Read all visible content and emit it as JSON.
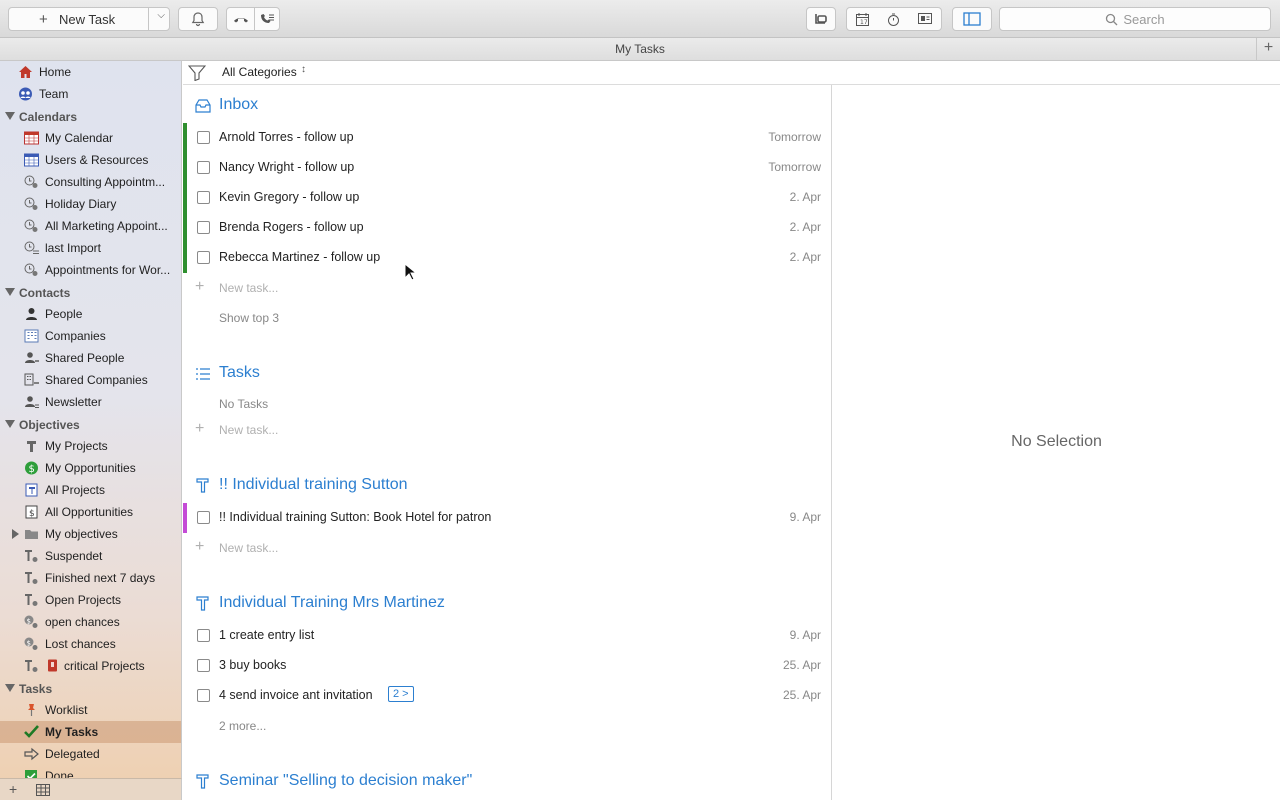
{
  "toolbar": {
    "new_task_label": "New Task",
    "search_placeholder": "Search"
  },
  "window": {
    "title": "My Tasks"
  },
  "filter": {
    "label": "All Categories"
  },
  "sidebar": {
    "top": [
      {
        "label": "Home",
        "icon": "home-icon"
      },
      {
        "label": "Team",
        "icon": "team-icon"
      }
    ],
    "sections": {
      "calendars": "Calendars",
      "contacts": "Contacts",
      "objectives": "Objectives",
      "tasks": "Tasks"
    },
    "calendars": [
      "My Calendar",
      "Users & Resources",
      "Consulting Appointm...",
      "Holiday Diary",
      "All Marketing Appoint...",
      "last Import",
      "Appointments for Wor..."
    ],
    "contacts": [
      "People",
      "Companies",
      "Shared People",
      "Shared Companies",
      "Newsletter"
    ],
    "objectives": [
      "My Projects",
      "My Opportunities",
      "All Projects",
      "All Opportunities",
      "My objectives",
      "Suspendet",
      "Finished next 7 days",
      "Open Projects",
      "open chances",
      "Lost chances",
      "critical Projects"
    ],
    "tasks": [
      "Worklist",
      "My Tasks",
      "Delegated",
      "Done"
    ]
  },
  "groups": {
    "inbox": {
      "title": "Inbox",
      "tasks": [
        {
          "title": "Arnold Torres - follow up",
          "date": "Tomorrow"
        },
        {
          "title": "Nancy Wright - follow up",
          "date": "Tomorrow"
        },
        {
          "title": "Kevin Gregory - follow up",
          "date": "2. Apr"
        },
        {
          "title": "Brenda Rogers - follow up",
          "date": "2. Apr"
        },
        {
          "title": "Rebecca Martinez - follow up",
          "date": "2. Apr"
        }
      ],
      "new_task": "New task...",
      "show_top": "Show top 3"
    },
    "tasks": {
      "title": "Tasks",
      "empty": "No Tasks",
      "new_task": "New task..."
    },
    "sutton": {
      "title": "!! Individual training Sutton",
      "tasks": [
        {
          "title": "!! Individual training Sutton: Book Hotel for patron",
          "date": "9. Apr"
        }
      ],
      "new_task": "New task..."
    },
    "martinez": {
      "title": "Individual Training Mrs Martinez",
      "tasks": [
        {
          "title": "1 create entry list",
          "date": "9. Apr"
        },
        {
          "title": "3 buy books",
          "date": "25. Apr"
        },
        {
          "title": "4 send invoice ant invitation",
          "date": "25. Apr",
          "badge": "2 >"
        }
      ],
      "more": "2 more..."
    },
    "seminar": {
      "title": "Seminar \"Selling to decision maker\""
    }
  },
  "detail": {
    "empty": "No Selection"
  },
  "colors": {
    "accent": "#2c7fd0",
    "inbox_bar": "#2f8f2f",
    "sutton_bar": "#c44bd6"
  }
}
